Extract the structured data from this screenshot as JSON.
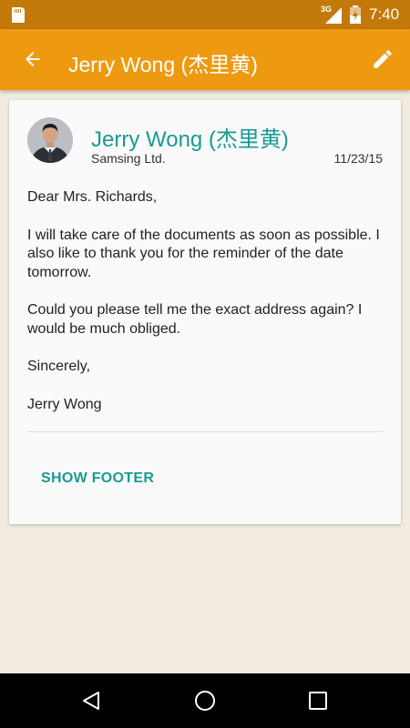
{
  "status_bar": {
    "network_type": "3G",
    "time": "7:40"
  },
  "app_bar": {
    "title": "Jerry Wong (杰里黄)",
    "back_icon": "arrow-back-icon",
    "edit_icon": "pencil-icon"
  },
  "message": {
    "sender_name": "Jerry Wong (杰里黄)",
    "sender_company": "Samsing Ltd.",
    "date": "11/23/15",
    "body": [
      "Dear Mrs. Richards,",
      "I will take care of the documents as soon as possible. I also like to thank you for the reminder of the date tomorrow.",
      "Could you please tell me the exact address again? I would be much obliged.",
      "Sincerely,",
      "Jerry Wong"
    ],
    "show_footer_label": "SHOW FOOTER"
  },
  "colors": {
    "status_bar": "#c2790a",
    "app_bar": "#ee9a10",
    "accent": "#1a9a93",
    "background": "#f2ebe0"
  }
}
